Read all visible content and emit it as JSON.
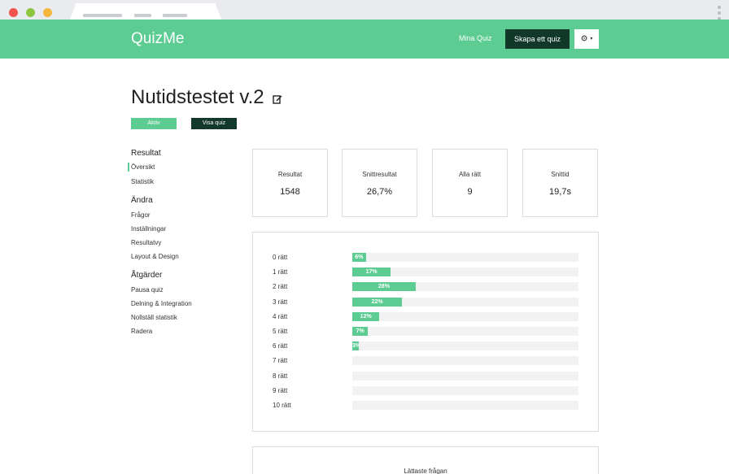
{
  "header": {
    "brand": "QuizMe",
    "nav_link": "Mina Quiz",
    "cta": "Skapa ett quiz",
    "settings_caret": "▾"
  },
  "quiz": {
    "title": "Nutidstestet v.2",
    "status_label": "Aktiv",
    "view_label": "Visa quiz"
  },
  "sidebar": {
    "sections": [
      {
        "title": "Resultat",
        "items": [
          "Översikt",
          "Statistik"
        ]
      },
      {
        "title": "Ändra",
        "items": [
          "Frågor",
          "Inställningar",
          "Resultatvy",
          "Layout & Design"
        ]
      },
      {
        "title": "Åtgärder",
        "items": [
          "Pausa quiz",
          "Delning & Integration",
          "Nollställ statistik",
          "Radera"
        ]
      }
    ]
  },
  "stats": [
    {
      "label": "Resultat",
      "value": "1548"
    },
    {
      "label": "Snittresultat",
      "value": "26,7%"
    },
    {
      "label": "Alla rätt",
      "value": "9"
    },
    {
      "label": "Snittid",
      "value": "19,7s"
    }
  ],
  "distribution": {
    "rows": [
      {
        "label": "0 rätt",
        "percent": 6,
        "text": "6%"
      },
      {
        "label": "1 rätt",
        "percent": 17,
        "text": "17%"
      },
      {
        "label": "2 rätt",
        "percent": 28,
        "text": "28%"
      },
      {
        "label": "3 rätt",
        "percent": 22,
        "text": "22%"
      },
      {
        "label": "4 rätt",
        "percent": 12,
        "text": "12%"
      },
      {
        "label": "5 rätt",
        "percent": 7,
        "text": "7%"
      },
      {
        "label": "6 rätt",
        "percent": 3,
        "text": "3%"
      },
      {
        "label": "7 rätt",
        "percent": 0,
        "text": ""
      },
      {
        "label": "8 rätt",
        "percent": 0,
        "text": ""
      },
      {
        "label": "9 rätt",
        "percent": 0,
        "text": ""
      },
      {
        "label": "10 rätt",
        "percent": 0,
        "text": ""
      }
    ]
  },
  "easiest": {
    "title": "Lättaste frågan"
  },
  "colors": {
    "accent": "#5ccc93",
    "dark": "#12382a"
  }
}
